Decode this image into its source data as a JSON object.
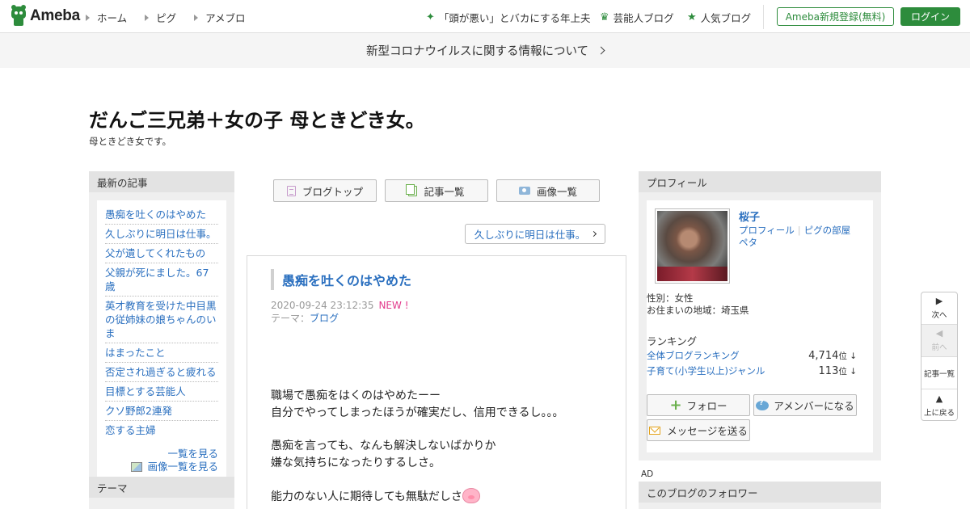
{
  "header": {
    "logo_text": "Ameba",
    "nav": [
      {
        "label": "ホーム"
      },
      {
        "label": "ピグ"
      },
      {
        "label": "アメブロ"
      }
    ],
    "featured": "「頭が悪い」とバカにする年上夫",
    "celebrity_blog": "芸能人ブログ",
    "popular_blog": "人気ブログ",
    "register_label": "Ameba新規登録(無料)",
    "login_label": "ログイン",
    "accent_color": "#2d8c3c"
  },
  "notice": {
    "text": "新型コロナウイルスに関する情報について"
  },
  "blog": {
    "title": "だんご三兄弟＋女の子 母ときどき女。",
    "description": "母ときどき女です。"
  },
  "left_sidebar": {
    "latest_heading": "最新の記事",
    "latest_items": [
      "愚痴を吐くのはやめた",
      "久しぶりに明日は仕事。",
      "父が遺してくれたもの",
      "父親が死にました。67歳",
      "英才教育を受けた中目黒の従姉妹の娘ちゃんのいま",
      "はまったこと",
      "否定され過ぎると疲れる",
      "目標とする芸能人",
      "クソ野郎2連発",
      "恋する主婦"
    ],
    "see_all": "一覧を見る",
    "see_images": "画像一覧を見る",
    "theme_heading": "テーマ"
  },
  "main": {
    "tabs": [
      {
        "label": "ブログトップ",
        "icon": "document-icon"
      },
      {
        "label": "記事一覧",
        "icon": "list-icon"
      },
      {
        "label": "画像一覧",
        "icon": "camera-icon"
      }
    ],
    "next_article": "久しぶりに明日は仕事。",
    "article": {
      "title": "愚痴を吐くのはやめた",
      "datetime": "2020-09-24 23:12:35",
      "new_badge": "NEW !",
      "theme_prefix": "テーマ：",
      "theme": "ブログ",
      "paragraphs": [
        [
          "職場で愚痴をはくのはやめたーー",
          "自分でやってしまったほうが確実だし、信用できるし。。。"
        ],
        [
          "愚痴を言っても、なんも解決しないばかりか",
          "嫌な気持ちになったりするしさ。"
        ],
        [
          "能力のない人に期待しても無駄だしさ"
        ]
      ]
    }
  },
  "right_sidebar": {
    "profile_heading": "プロフィール",
    "name": "桜子",
    "profile_link": "プロフィール",
    "pigg_room": "ピグの部屋",
    "peta": "ペタ",
    "gender": "性別：女性",
    "region": "お住まいの地域：埼玉県",
    "ranking_heading": "ランキング",
    "rankings": [
      {
        "label": "全体ブログランキング",
        "value": "4,714",
        "unit": "位 ↓"
      },
      {
        "label": "子育て(小学生以上)ジャンル",
        "value": "113",
        "unit": "位 ↓"
      }
    ],
    "follow_label": "フォロー",
    "amember_label": "アメンバーになる",
    "message_label": "メッセージを送る",
    "ad_label": "AD",
    "followers_heading": "このブログのフォロワー"
  },
  "float_nav": {
    "next": "次へ",
    "prev": "前へ",
    "list": "記事一覧",
    "top": "上に戻る"
  }
}
